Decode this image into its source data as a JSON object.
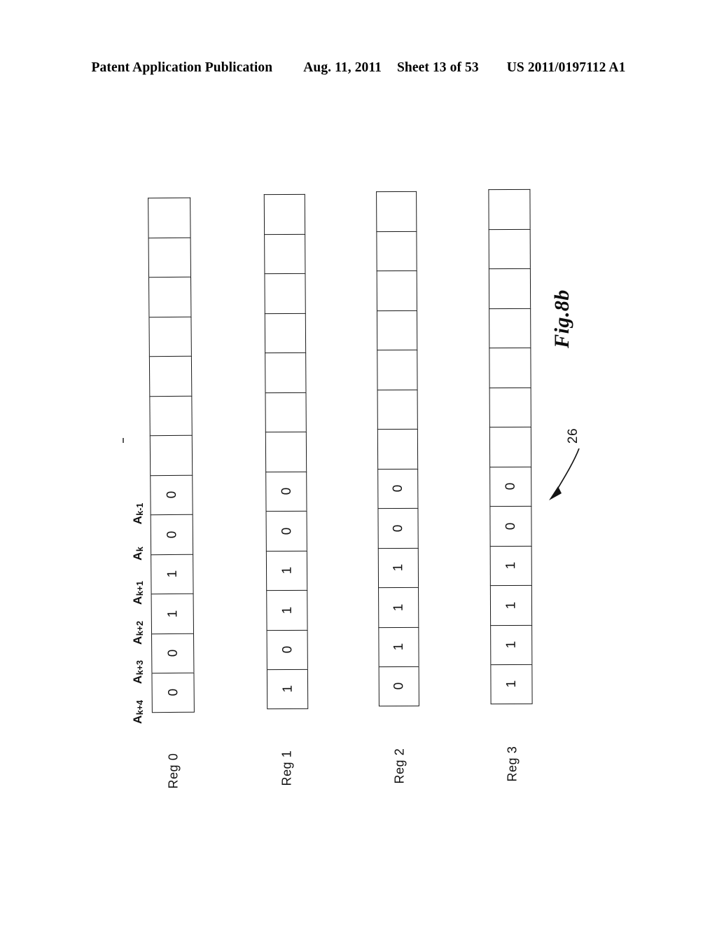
{
  "header": {
    "publication": "Patent Application Publication",
    "date": "Aug. 11, 2011",
    "sheet": "Sheet 13 of 53",
    "number": "US 2011/0197112 A1"
  },
  "figure": {
    "caption": "Fig.8b",
    "reference_numeral": "26"
  },
  "diagram": {
    "bit_labels": [
      {
        "base": "A",
        "sub": "k-1"
      },
      {
        "base": "A",
        "sub": "k"
      },
      {
        "base": "A",
        "sub": "k+1"
      },
      {
        "base": "A",
        "sub": "k+2"
      },
      {
        "base": "A",
        "sub": "k+3"
      },
      {
        "base": "A",
        "sub": "k+4"
      }
    ],
    "empty_cells_per_column": 7,
    "registers": [
      {
        "name": "Reg 0",
        "bits": [
          "0",
          "0",
          "1",
          "1",
          "0",
          "0"
        ]
      },
      {
        "name": "Reg 1",
        "bits": [
          "0",
          "0",
          "1",
          "1",
          "0",
          "1"
        ]
      },
      {
        "name": "Reg 2",
        "bits": [
          "0",
          "0",
          "1",
          "1",
          "1",
          "0"
        ]
      },
      {
        "name": "Reg 3",
        "bits": [
          "0",
          "0",
          "1",
          "1",
          "1",
          "1"
        ]
      }
    ]
  },
  "colors": {
    "ink": "#111111",
    "page": "#ffffff"
  }
}
